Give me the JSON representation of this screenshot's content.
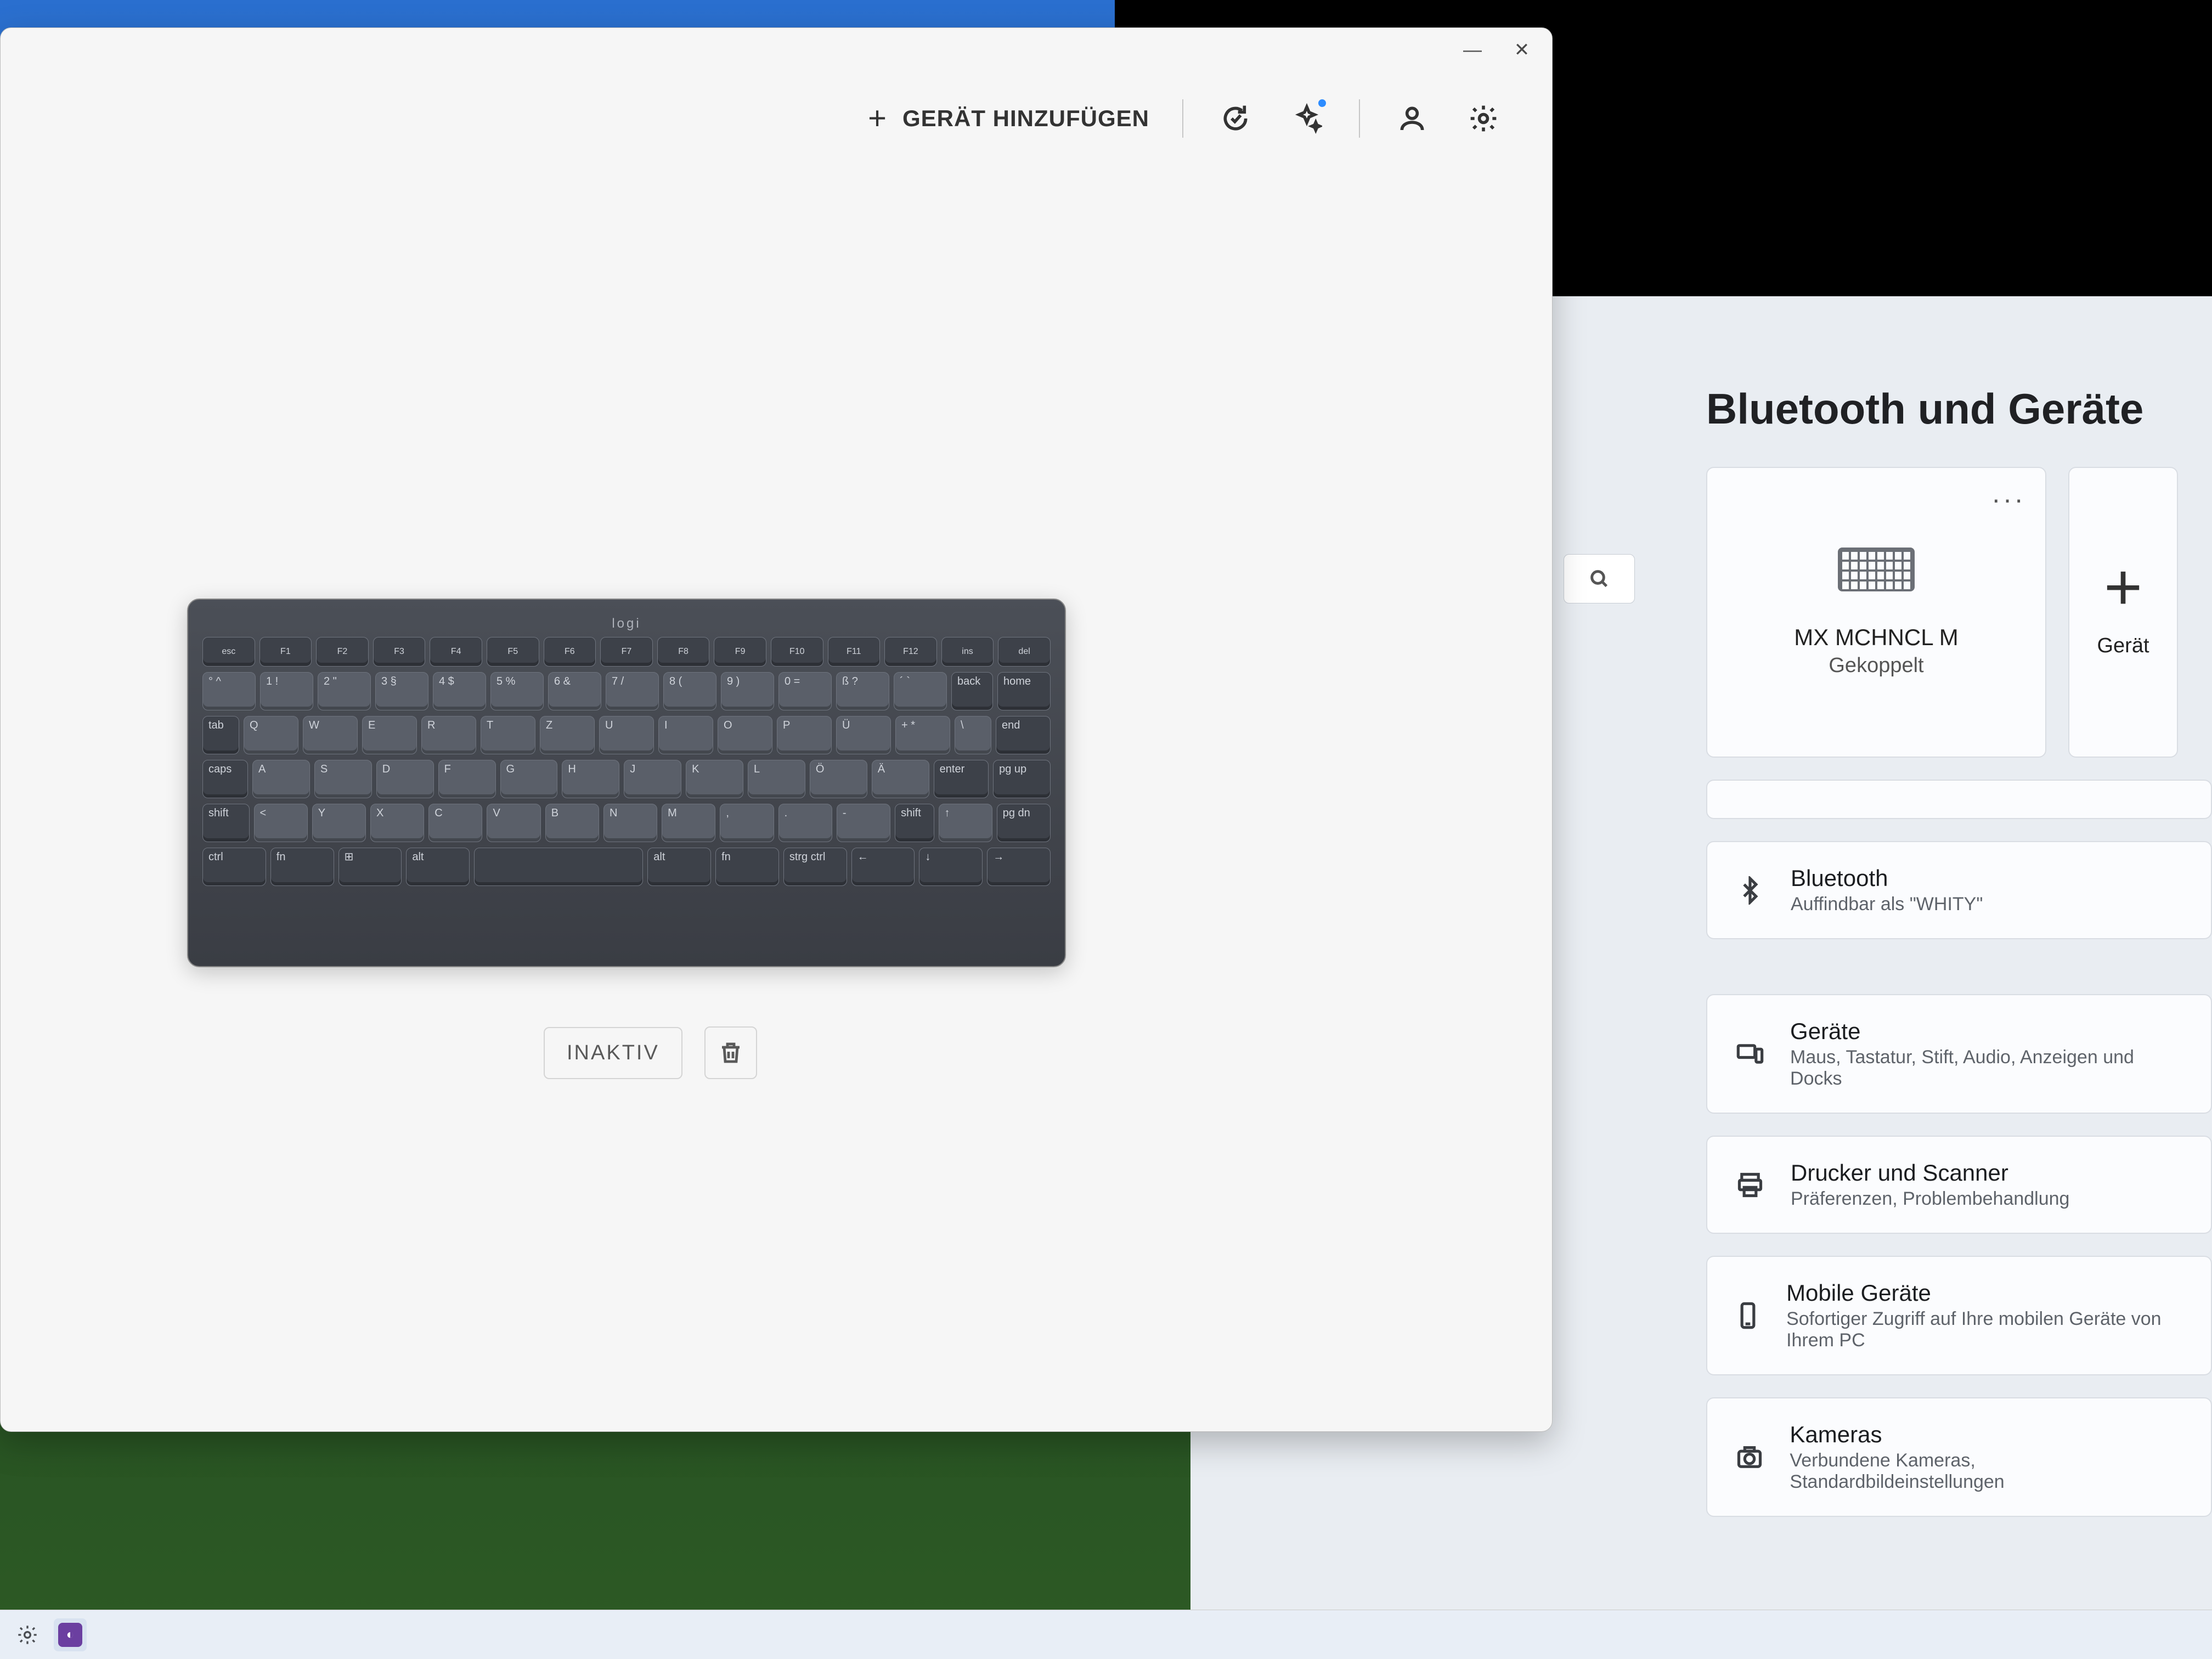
{
  "logi": {
    "toolbar": {
      "add_device_label": "GERÄT HINZUFÜGEN"
    },
    "device": {
      "brand": "logi",
      "status_label": "INAKTIV"
    },
    "keyboard_rows": [
      [
        "esc",
        "F1",
        "F2",
        "F3",
        "F4",
        "F5",
        "F6",
        "F7",
        "F8",
        "F9",
        "F10",
        "F11",
        "F12",
        "ins",
        "del"
      ],
      [
        "° ^",
        "1 !",
        "2 \"",
        "3 §",
        "4 $",
        "5 %",
        "6 &",
        "7 /",
        "8 (",
        "9 )",
        "0 =",
        "ß ?",
        "´ `",
        "back",
        "home"
      ],
      [
        "tab",
        "Q",
        "W",
        "E",
        "R",
        "T",
        "Z",
        "U",
        "I",
        "O",
        "P",
        "Ü",
        "+ *",
        "\\",
        "end"
      ],
      [
        "caps",
        "A",
        "S",
        "D",
        "F",
        "G",
        "H",
        "J",
        "K",
        "L",
        "Ö",
        "Ä",
        "enter",
        "pg up"
      ],
      [
        "shift",
        "<",
        "Y",
        "X",
        "C",
        "V",
        "B",
        "N",
        "M",
        ",",
        ".",
        "-",
        "shift",
        "↑",
        "pg dn"
      ],
      [
        "ctrl",
        "fn",
        "⊞",
        "alt",
        "",
        "alt",
        "fn",
        "strg ctrl",
        "←",
        "↓",
        "→"
      ]
    ]
  },
  "settings": {
    "page_title": "Bluetooth und Geräte",
    "device_tile": {
      "name": "MX MCHNCL M",
      "status": "Gekoppelt"
    },
    "add_tile": {
      "label": "Gerät"
    },
    "bluetooth_row": {
      "title": "Bluetooth",
      "subtitle": "Auffindbar als \"WHITY\""
    },
    "rows": [
      {
        "title": "Geräte",
        "subtitle": "Maus, Tastatur, Stift, Audio, Anzeigen und Docks"
      },
      {
        "title": "Drucker und Scanner",
        "subtitle": "Präferenzen, Problembehandlung"
      },
      {
        "title": "Mobile Geräte",
        "subtitle": "Sofortiger Zugriff auf Ihre mobilen Geräte von Ihrem PC"
      },
      {
        "title": "Kameras",
        "subtitle": "Verbundene Kameras, Standardbildeinstellungen"
      }
    ]
  }
}
